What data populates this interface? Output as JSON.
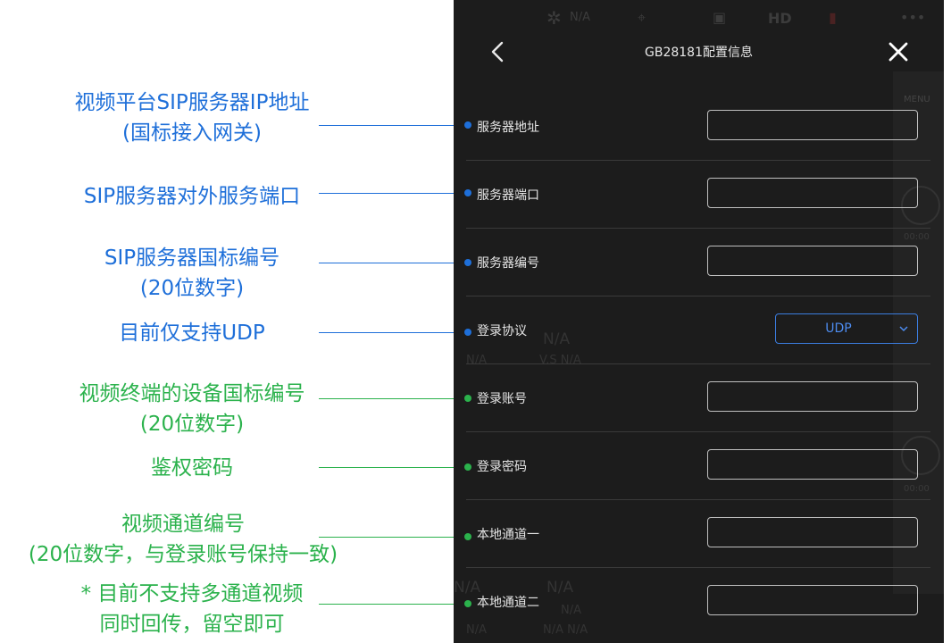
{
  "colors": {
    "annotation_blue": "#1e6fd9",
    "annotation_green": "#2bb24c",
    "panel_bg": "#1c1c1c",
    "accent": "#4d8cf0"
  },
  "statusbar": {
    "drone_status": "N/A",
    "hd_label": "HD",
    "more": "•••"
  },
  "header": {
    "title": "GB28181配置信息",
    "back_icon": "chevron-left-icon",
    "close_icon": "close-icon"
  },
  "sidebar": {
    "menu_label": "MENU",
    "time1": "00:00",
    "time2": "00:00"
  },
  "ghost": {
    "a": "N/A",
    "b": "N/A",
    "c": "V.S  N/A",
    "d": "N/A",
    "e": "N/A",
    "f": "N/A",
    "g": "N/A",
    "h": "N/A  N/A"
  },
  "form": {
    "rows": [
      {
        "label": "服务器地址",
        "value": ""
      },
      {
        "label": "服务器端口",
        "value": ""
      },
      {
        "label": "服务器编号",
        "value": ""
      },
      {
        "label": "登录协议",
        "value": "UDP"
      },
      {
        "label": "登录账号",
        "value": ""
      },
      {
        "label": "登录密码",
        "value": ""
      },
      {
        "label": "本地通道一",
        "value": ""
      },
      {
        "label": "本地通道二",
        "value": ""
      }
    ]
  },
  "annotations": [
    {
      "lines": [
        "视频平台SIP服务器IP地址",
        "(国标接入网关)"
      ],
      "color": "blue"
    },
    {
      "lines": [
        "SIP服务器对外服务端口"
      ],
      "color": "blue"
    },
    {
      "lines": [
        "SIP服务器国标编号",
        "(20位数字)"
      ],
      "color": "blue"
    },
    {
      "lines": [
        "目前仅支持UDP"
      ],
      "color": "blue"
    },
    {
      "lines": [
        "视频终端的设备国标编号",
        "(20位数字)"
      ],
      "color": "green"
    },
    {
      "lines": [
        "鉴权密码"
      ],
      "color": "green"
    },
    {
      "lines": [
        "视频通道编号",
        "(20位数字，与登录账号保持一致)"
      ],
      "color": "green"
    },
    {
      "lines": [
        "* 目前不支持多通道视频",
        "同时回传，留空即可"
      ],
      "color": "green"
    }
  ]
}
